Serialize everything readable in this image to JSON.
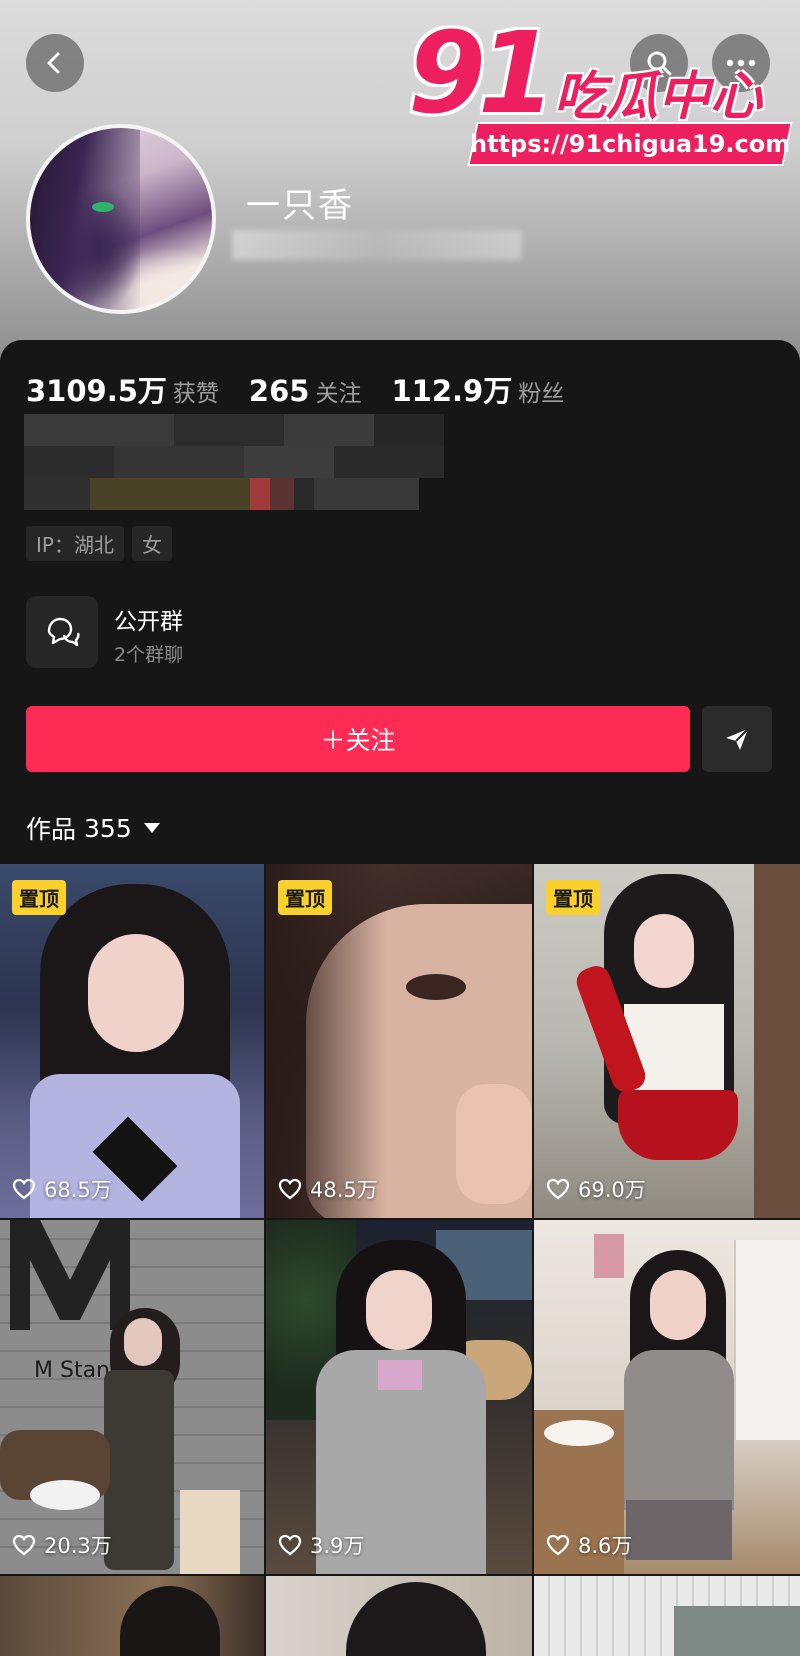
{
  "header": {
    "username": "一只香",
    "watermark": {
      "logo_number": "91",
      "logo_text": "吃瓜中心",
      "url": "https://91chigua19.com"
    }
  },
  "stats": [
    {
      "value": "3109.5万",
      "label": "获赞"
    },
    {
      "value": "265",
      "label": "关注"
    },
    {
      "value": "112.9万",
      "label": "粉丝"
    }
  ],
  "tags": [
    "IP：湖北",
    "女"
  ],
  "group": {
    "title": "公开群",
    "subtitle": "2个群聊"
  },
  "follow_button": "＋关注",
  "works": {
    "label": "作品",
    "count": "355"
  },
  "videos": [
    {
      "pinned": "置顶",
      "likes": "68.5万"
    },
    {
      "pinned": "置顶",
      "likes": "48.5万"
    },
    {
      "pinned": "置顶",
      "likes": "69.0万"
    },
    {
      "pinned": "",
      "likes": "20.3万",
      "overlay_text": "M Stand"
    },
    {
      "pinned": "",
      "likes": "3.9万"
    },
    {
      "pinned": "",
      "likes": "8.6万"
    }
  ],
  "colors": {
    "accent": "#fe2c55",
    "pin_badge": "#fad02c",
    "watermark": "#ee1f5f",
    "background": "#161616"
  }
}
